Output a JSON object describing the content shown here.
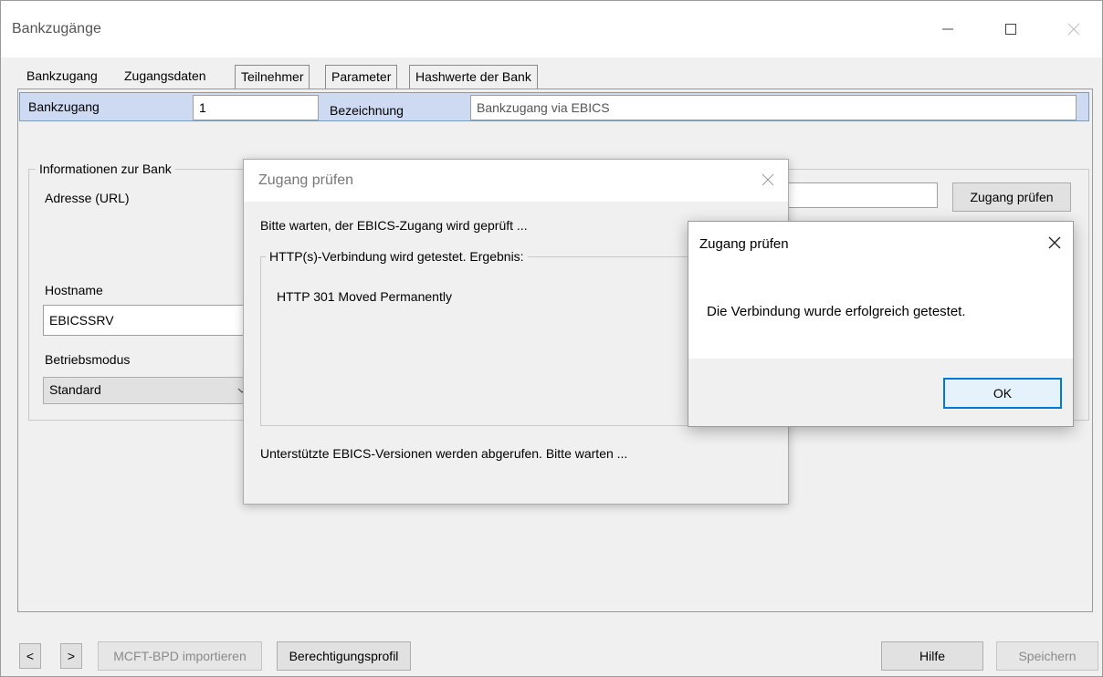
{
  "window": {
    "title": "Bankzugänge"
  },
  "tabs": [
    "Bankzugang",
    "Zugangsdaten",
    "Teilnehmer",
    "Parameter",
    "Hashwerte der Bank"
  ],
  "header": {
    "bankzugang_label": "Bankzugang",
    "bankzugang_value": "1",
    "bezeichnung_label": "Bezeichnung",
    "bezeichnung_value": "Bankzugang via EBICS"
  },
  "bank_info": {
    "group_label": "Informationen zur Bank",
    "adresse_label": "Adresse (URL)",
    "zugang_pruefen_button": "Zugang prüfen",
    "hostname_label": "Hostname",
    "hostname_value": "EBICSSRV",
    "betriebsmodus_label": "Betriebsmodus",
    "betriebsmodus_value": "Standard"
  },
  "progress_dialog": {
    "title": "Zugang prüfen",
    "wait_text": "Bitte warten, der EBICS-Zugang wird geprüft ...",
    "group_label": "HTTP(s)-Verbindung wird getestet. Ergebnis:",
    "result_text": "HTTP 301 Moved Permanently",
    "footer_text": "Unterstützte EBICS-Versionen werden abgerufen. Bitte warten ..."
  },
  "message_dialog": {
    "title": "Zugang prüfen",
    "message": "Die Verbindung wurde erfolgreich getestet.",
    "ok_label": "OK"
  },
  "footer": {
    "prev_label": "<",
    "next_label": ">",
    "import_label": "MCFT-BPD importieren",
    "profile_label": "Berechtigungsprofil",
    "help_label": "Hilfe",
    "save_label": "Speichern"
  }
}
